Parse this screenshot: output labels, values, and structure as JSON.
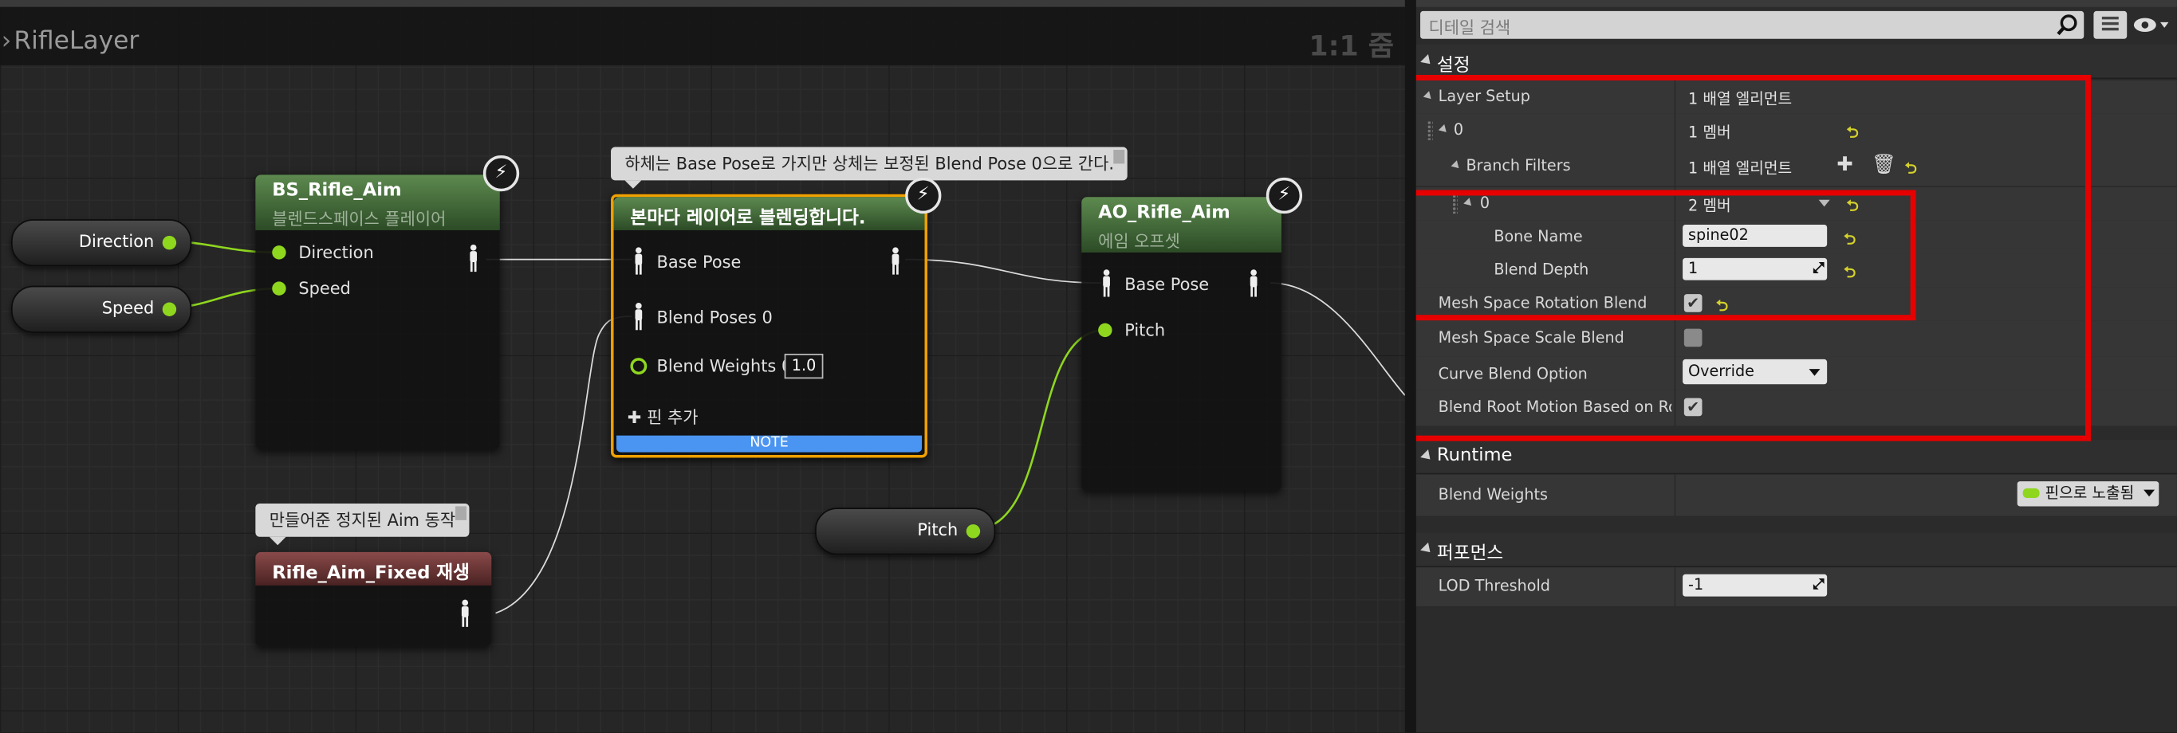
{
  "graph": {
    "title": "RifleLayer",
    "zoom": "1:1 줌",
    "nodes": {
      "bs_rifle_aim": {
        "title": "BS_Rifle_Aim",
        "subtitle": "블렌드스페이스 플레이어",
        "pins": [
          "Direction",
          "Speed"
        ]
      },
      "layered_blend": {
        "title": "본마다 레이어로 블렌딩합니다.",
        "pins": [
          "Base Pose",
          "Blend Poses 0",
          "Blend Weights 0"
        ],
        "weight_value": "1.0",
        "add_pin": "핀 추가",
        "note": "NOTE"
      },
      "ao_rifle_aim": {
        "title": "AO_Rifle_Aim",
        "subtitle": "에임 오프셋",
        "pins": [
          "Base Pose",
          "Pitch"
        ]
      },
      "rifle_aim_fixed": {
        "title": "Rifle_Aim_Fixed 재생"
      }
    },
    "variables": {
      "direction": "Direction",
      "speed": "Speed",
      "pitch": "Pitch"
    },
    "comments": {
      "layered": "하체는 Base Pose로 가지만 상체는 보정된 Blend Pose 0으로  간다.",
      "fixed": "만들어준 정지된 Aim 동작"
    }
  },
  "details": {
    "search_placeholder": "디테일 검색",
    "categories": {
      "settings": "설정",
      "runtime": "Runtime",
      "performance": "퍼포먼스"
    },
    "rows": {
      "layer_setup": {
        "label": "Layer Setup",
        "value": "1 배열 엘리먼트"
      },
      "index0": {
        "label": "0",
        "value": "1 멤버"
      },
      "branch_filters": {
        "label": "Branch Filters",
        "value": "1 배열 엘리먼트"
      },
      "bf_index0": {
        "label": "0",
        "value": "2 멤버"
      },
      "bone_name": {
        "label": "Bone Name",
        "value": "spine02"
      },
      "blend_depth": {
        "label": "Blend Depth",
        "value": "1"
      },
      "mesh_rot": {
        "label": "Mesh Space Rotation Blend",
        "checked": true
      },
      "mesh_scale": {
        "label": "Mesh Space Scale Blend",
        "checked": false
      },
      "curve_blend": {
        "label": "Curve Blend Option",
        "value": "Override"
      },
      "root_motion": {
        "label": "Blend Root Motion Based on Root I",
        "checked": true
      },
      "blend_weights": {
        "label": "Blend Weights",
        "value": "핀으로 노출됨"
      },
      "lod": {
        "label": "LOD Threshold",
        "value": "-1"
      }
    }
  },
  "colors": {
    "highlight": "#e60000",
    "pin_green": "#8fd61f",
    "accent_yellow": "#d6d22b"
  }
}
